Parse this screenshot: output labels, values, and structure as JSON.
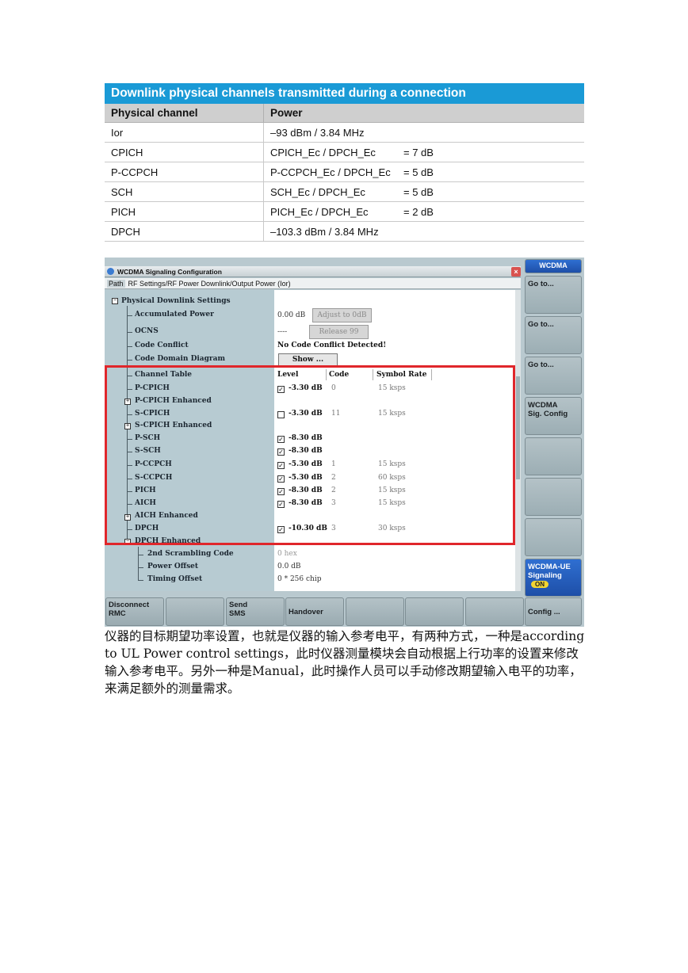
{
  "table": {
    "caption": "Downlink physical channels transmitted during a connection",
    "headers": [
      "Physical channel",
      "Power"
    ],
    "rows": [
      {
        "channel": "Ior",
        "param": "–93 dBm / 3.84 MHz",
        "value": ""
      },
      {
        "channel": "CPICH",
        "param": "CPICH_Ec / DPCH_Ec",
        "value": "= 7 dB"
      },
      {
        "channel": "P-CCPCH",
        "param": "P-CCPCH_Ec / DPCH_Ec",
        "value": "= 5 dB"
      },
      {
        "channel": "SCH",
        "param": "SCH_Ec / DPCH_Ec",
        "value": "= 5 dB"
      },
      {
        "channel": "PICH",
        "param": "PICH_Ec / DPCH_Ec",
        "value": "= 2 dB"
      },
      {
        "channel": "DPCH",
        "param": "–103.3 dBm / 3.84 MHz",
        "value": ""
      }
    ]
  },
  "instrument": {
    "window_title": "WCDMA Signaling Configuration",
    "close_glyph": "×",
    "path_label": "Path",
    "path_value": "RF Settings/RF Power Downlink/Output Power (Ior)",
    "tree": {
      "phys_dl": "Physical Downlink Settings",
      "acc_power": "Accumulated Power",
      "ocns": "OCNS",
      "code_conflict": "Code Conflict",
      "code_domain": "Code Domain Diagram",
      "channel_table": "Channel Table",
      "p_cpich": "P-CPICH",
      "p_cpich_enh": "P-CPICH Enhanced",
      "s_cpich": "S-CPICH",
      "s_cpich_enh": "S-CPICH Enhanced",
      "p_sch": "P-SCH",
      "s_sch": "S-SCH",
      "p_ccpch": "P-CCPCH",
      "s_ccpch": "S-CCPCH",
      "pich": "PICH",
      "aich": "AICH",
      "aich_enh": "AICH Enhanced",
      "dpch": "DPCH",
      "dpch_enh": "DPCH Enhanced",
      "scramb": "2nd Scrambling Code",
      "power_offset": "Power Offset",
      "timing_offset": "Timing Offset"
    },
    "values": {
      "acc_power": "0.00 dB",
      "adjust_btn": "Adjust to 0dB",
      "ocns": "----",
      "release_btn": "Release 99",
      "code_conflict": "No Code Conflict Detected!",
      "show_btn": "Show ...",
      "col_level": "Level",
      "col_code": "Code",
      "col_symrate": "Symbol Rate",
      "scramb": "0 hex",
      "power_offset": "0.0 dB",
      "timing_offset": "0 * 256 chip"
    },
    "channels": [
      {
        "key": "p_cpich",
        "checked": true,
        "level": "-3.30 dB",
        "code": "0",
        "rate": "15 ksps"
      },
      {
        "key": "s_cpich",
        "checked": false,
        "level": "-3.30 dB",
        "code": "11",
        "rate": "15 ksps"
      },
      {
        "key": "p_sch",
        "checked": true,
        "level": "-8.30 dB",
        "code": "",
        "rate": ""
      },
      {
        "key": "s_sch",
        "checked": true,
        "level": "-8.30 dB",
        "code": "",
        "rate": ""
      },
      {
        "key": "p_ccpch",
        "checked": true,
        "level": "-5.30 dB",
        "code": "1",
        "rate": "15 ksps"
      },
      {
        "key": "s_ccpch",
        "checked": true,
        "level": "-5.30 dB",
        "code": "2",
        "rate": "60 ksps"
      },
      {
        "key": "pich",
        "checked": true,
        "level": "-8.30 dB",
        "code": "2",
        "rate": "15 ksps"
      },
      {
        "key": "aich",
        "checked": true,
        "level": "-8.30 dB",
        "code": "3",
        "rate": "15 ksps"
      },
      {
        "key": "dpch",
        "checked": true,
        "level": "-10.30 dB",
        "code": "3",
        "rate": "30 ksps"
      }
    ],
    "check_glyph": "✓",
    "side_keys": {
      "wcdma": "WCDMA",
      "goto1": "Go to...",
      "goto2": "Go to...",
      "goto3": "Go to...",
      "sigconfig_l1": "WCDMA",
      "sigconfig_l2": "Sig. Config",
      "ue_l1": "WCDMA-UE",
      "ue_l2": "Signaling",
      "ue_on": "ON"
    },
    "bottom_keys": {
      "disconnect_l1": "Disconnect",
      "disconnect_l2": "RMC",
      "send_l1": "Send",
      "send_l2": "SMS",
      "handover": "Handover",
      "config": "Config ..."
    },
    "colors": {
      "highlight_box": "#e0262b",
      "header_blue": "#1a9ad6"
    }
  },
  "paragraph": "仪器的目标期望功率设置，也就是仪器的输入参考电平，有两种方式，一种是according to UL Power control settings，此时仪器测量模块会自动根据上行功率的设置来修改输入参考电平。另外一种是Manual，此时操作人员可以手动修改期望输入电平的功率，来满足额外的测量需求。"
}
